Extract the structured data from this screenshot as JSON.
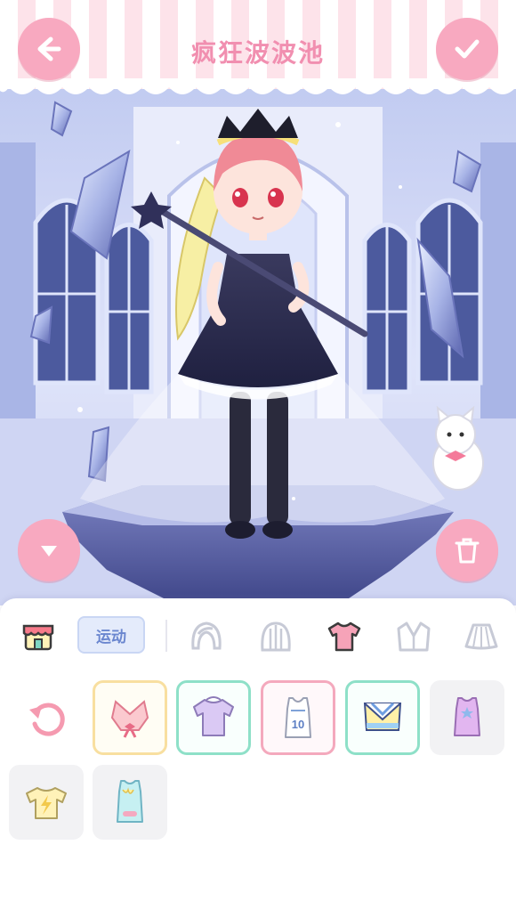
{
  "header": {
    "title": "疯狂波波池",
    "back_icon": "arrow-left-icon",
    "confirm_icon": "check-icon"
  },
  "scene": {
    "left_button_icon": "chevron-down-icon",
    "right_button_icon": "trash-icon"
  },
  "category_bar": {
    "shop_icon": "shop-icon",
    "active_tag": "运动",
    "tabs": [
      "hair-front",
      "hair-back",
      "top",
      "jacket",
      "skirt"
    ],
    "selected_tab": "top"
  },
  "items": {
    "reset_icon": "reset-icon",
    "grid": [
      {
        "name": "pink-bow-top",
        "frame": "yellow"
      },
      {
        "name": "lavender-tshirt",
        "frame": "mint"
      },
      {
        "name": "basketball-jersey",
        "frame": "pink",
        "number": "10"
      },
      {
        "name": "cheer-top",
        "frame": "mint"
      },
      {
        "name": "purple-star-tank",
        "frame": "none"
      },
      {
        "name": "yellow-lightning-tee",
        "frame": "none"
      },
      {
        "name": "mint-drip-tank",
        "frame": "none"
      }
    ]
  },
  "colors": {
    "accent_pink": "#f8a9c0",
    "title_pink": "#f18fb0",
    "tag_blue": "#6a86cf"
  }
}
